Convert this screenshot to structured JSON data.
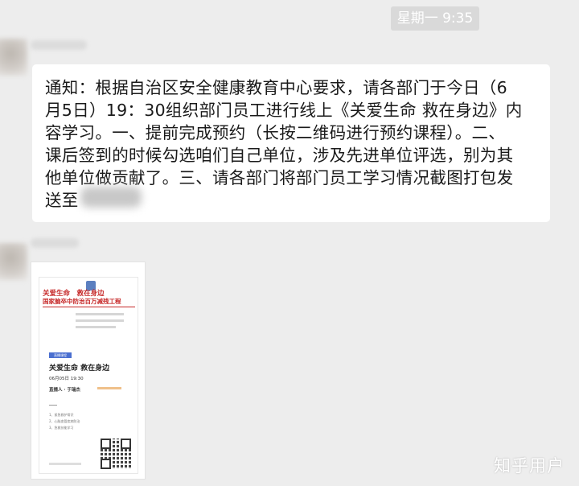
{
  "chat": {
    "timestamp": "星期一 9:35",
    "message": {
      "text": "通知：根据自治区安全健康教育中心要求，请各部门于今日（6\n月5日）19：30组织部门员工进行线上《关爱生命 救在身边》内\n容学习。一、提前完成预约（长按二维码进行预约课程）。二、\n课后签到的时候勾选咱们自己单位，涉及先进单位评选，别为其\n他单位做贡献了。三、请各部门将部门员工学习情况截图打包发\n送至"
    },
    "image_message": {
      "poster": {
        "headline": "关爱生命　救在身边",
        "subheadline": "国家脑卒中防治百万减残工程",
        "tag": "直播课程",
        "title": "关爱生命 救在身边",
        "datetime": "06月05日 19:30",
        "host_label": "直播人 ·  于瑞杰",
        "items": [
          "1、紧急救护常识",
          "2、心脑血管疾病防治",
          "3、急救技能学习"
        ]
      }
    }
  },
  "watermark": "知乎用户"
}
